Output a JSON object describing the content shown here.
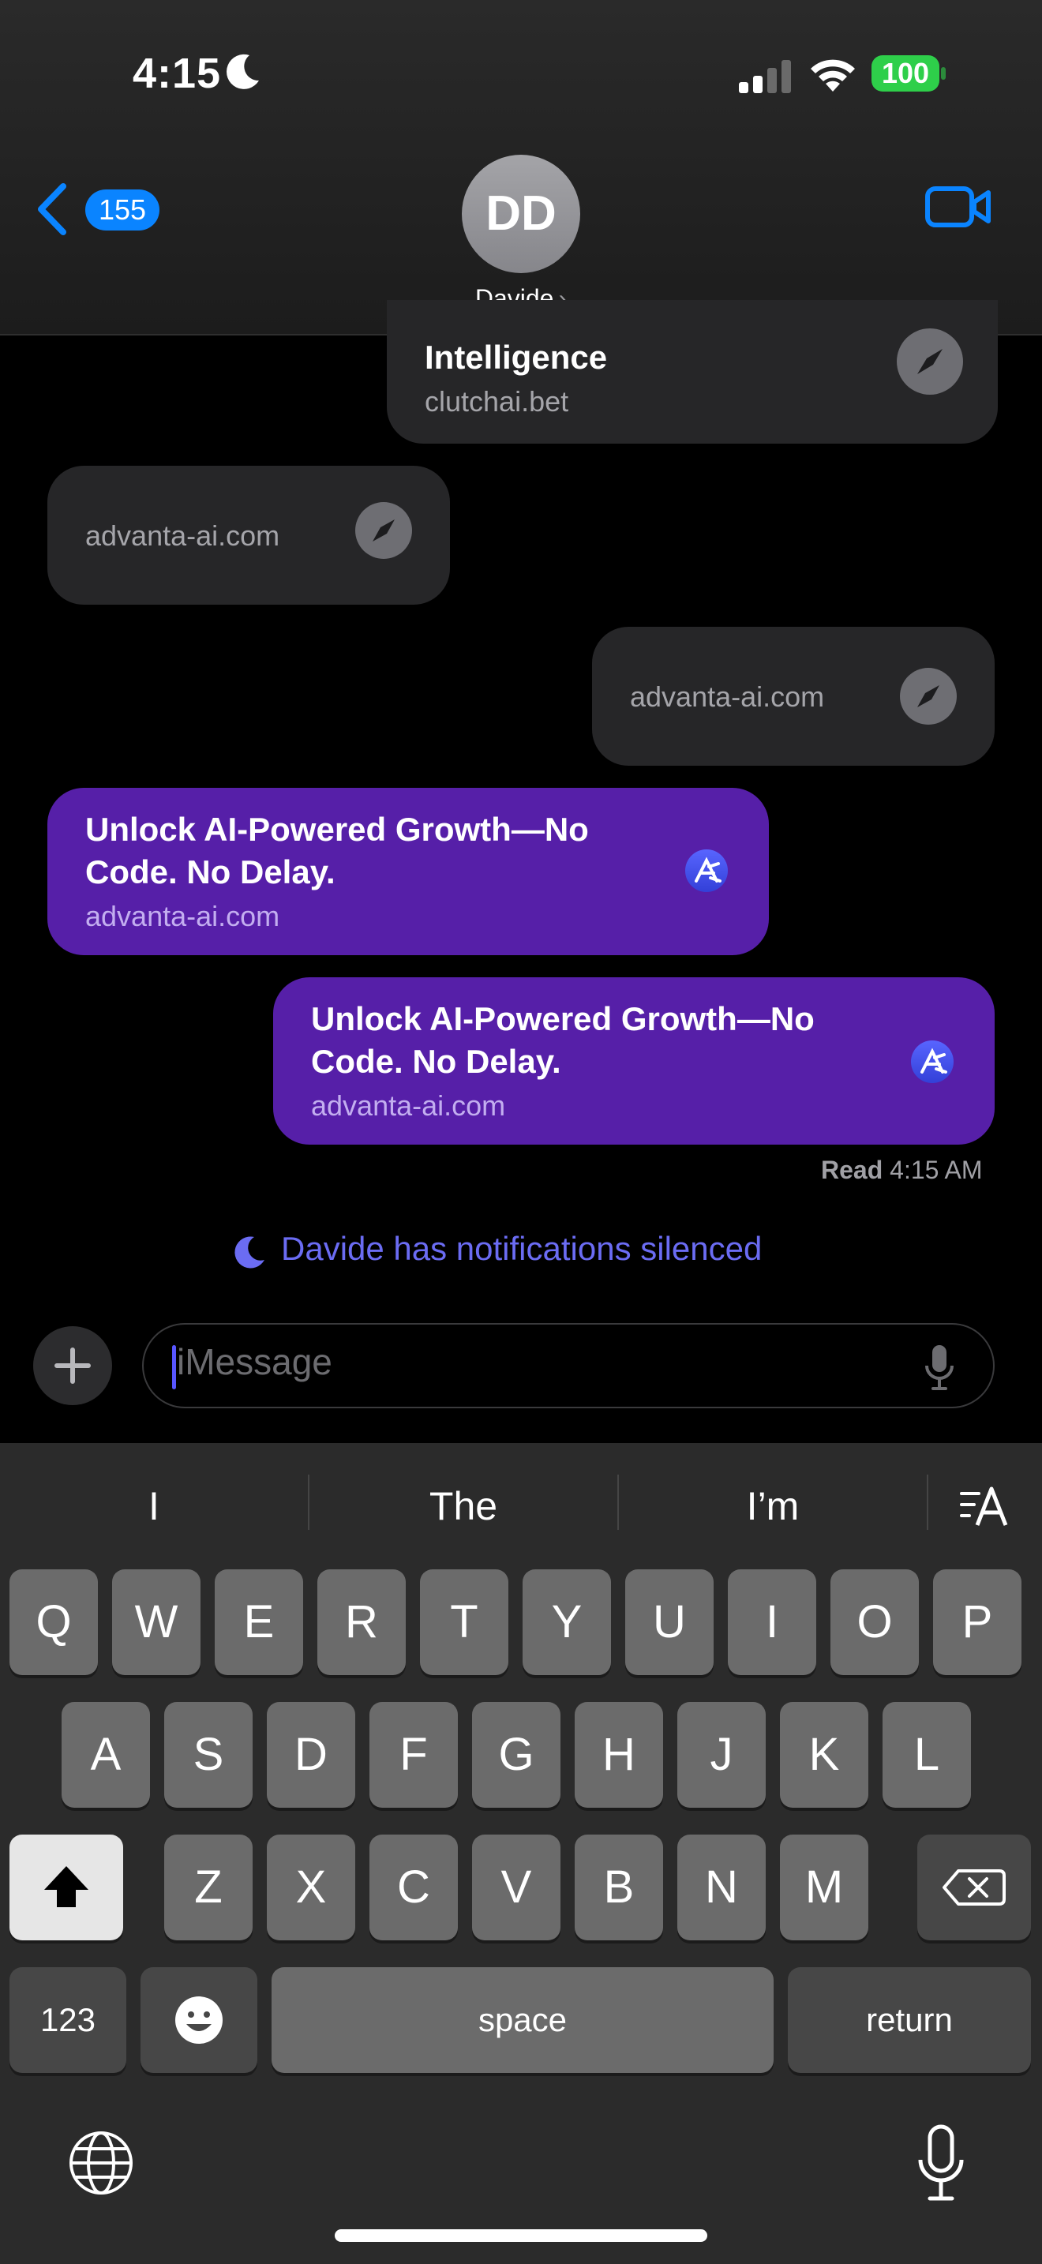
{
  "status_bar": {
    "time": "4:15",
    "battery": "100"
  },
  "header": {
    "back_count": "155",
    "avatar_initials": "DD",
    "contact_name": "Davide",
    "chevron": "›"
  },
  "messages": {
    "m1": {
      "title": "Intelligence",
      "url": "clutchai.bet"
    },
    "m2": {
      "url": "advanta-ai.com"
    },
    "m3": {
      "url": "advanta-ai.com"
    },
    "m4": {
      "title_line1": "Unlock AI-Powered Growth—No",
      "title_line2": "Code. No Delay.",
      "url": "advanta-ai.com"
    },
    "m5": {
      "title_line1": "Unlock AI-Powered Growth—No",
      "title_line2": "Code. No Delay.",
      "url": "advanta-ai.com"
    }
  },
  "read_receipt": {
    "label": "Read",
    "time": "4:15 AM"
  },
  "silenced_notice": "Davide has notifications silenced",
  "compose": {
    "placeholder": "iMessage"
  },
  "keyboard": {
    "suggestions": [
      "I",
      "The",
      "I’m"
    ],
    "row1": [
      "Q",
      "W",
      "E",
      "R",
      "T",
      "Y",
      "U",
      "I",
      "O",
      "P"
    ],
    "row2": [
      "A",
      "S",
      "D",
      "F",
      "G",
      "H",
      "J",
      "K",
      "L"
    ],
    "row3": [
      "Z",
      "X",
      "C",
      "V",
      "B",
      "N",
      "M"
    ],
    "numbers_label": "123",
    "space_label": "space",
    "return_label": "return"
  },
  "colors": {
    "accent_blue": "#0a84ff",
    "bubble_gray": "#262628",
    "bubble_purple": "#561fa8",
    "battery_green": "#2ecf4a",
    "silenced_text": "#6b6cf3"
  }
}
